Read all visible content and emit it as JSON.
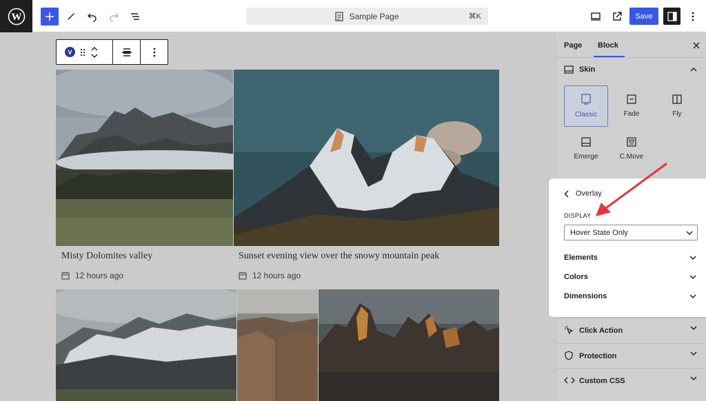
{
  "topbar": {
    "logo_icon": "wordpress-logo",
    "add_icon": "plus-icon",
    "doc_title": "Sample Page",
    "doc_shortcut": "⌘K",
    "save_label": "Save",
    "accent_color": "#3858e9"
  },
  "block_toolbar": {
    "badge_letter": "V"
  },
  "gallery": {
    "items": [
      {
        "title": "Misty Dolomites valley",
        "time": "12 hours ago"
      },
      {
        "title": "Sunset evening view over the snowy mountain peak",
        "time": "12 hours ago"
      }
    ]
  },
  "sidebar": {
    "tabs": [
      "Page",
      "Block"
    ],
    "active_tab": "Block",
    "skin_panel": {
      "title": "Skin",
      "options": [
        "Classic",
        "Fade",
        "Fly",
        "Emerge",
        "C.Move"
      ],
      "selected": "Classic"
    },
    "rows": [
      "Click Action",
      "Protection",
      "Custom CSS"
    ]
  },
  "overlay": {
    "title": "Overlay",
    "display_label": "DISPLAY",
    "display_value": "Hover State Only",
    "sections": [
      "Elements",
      "Colors",
      "Dimensions"
    ]
  }
}
